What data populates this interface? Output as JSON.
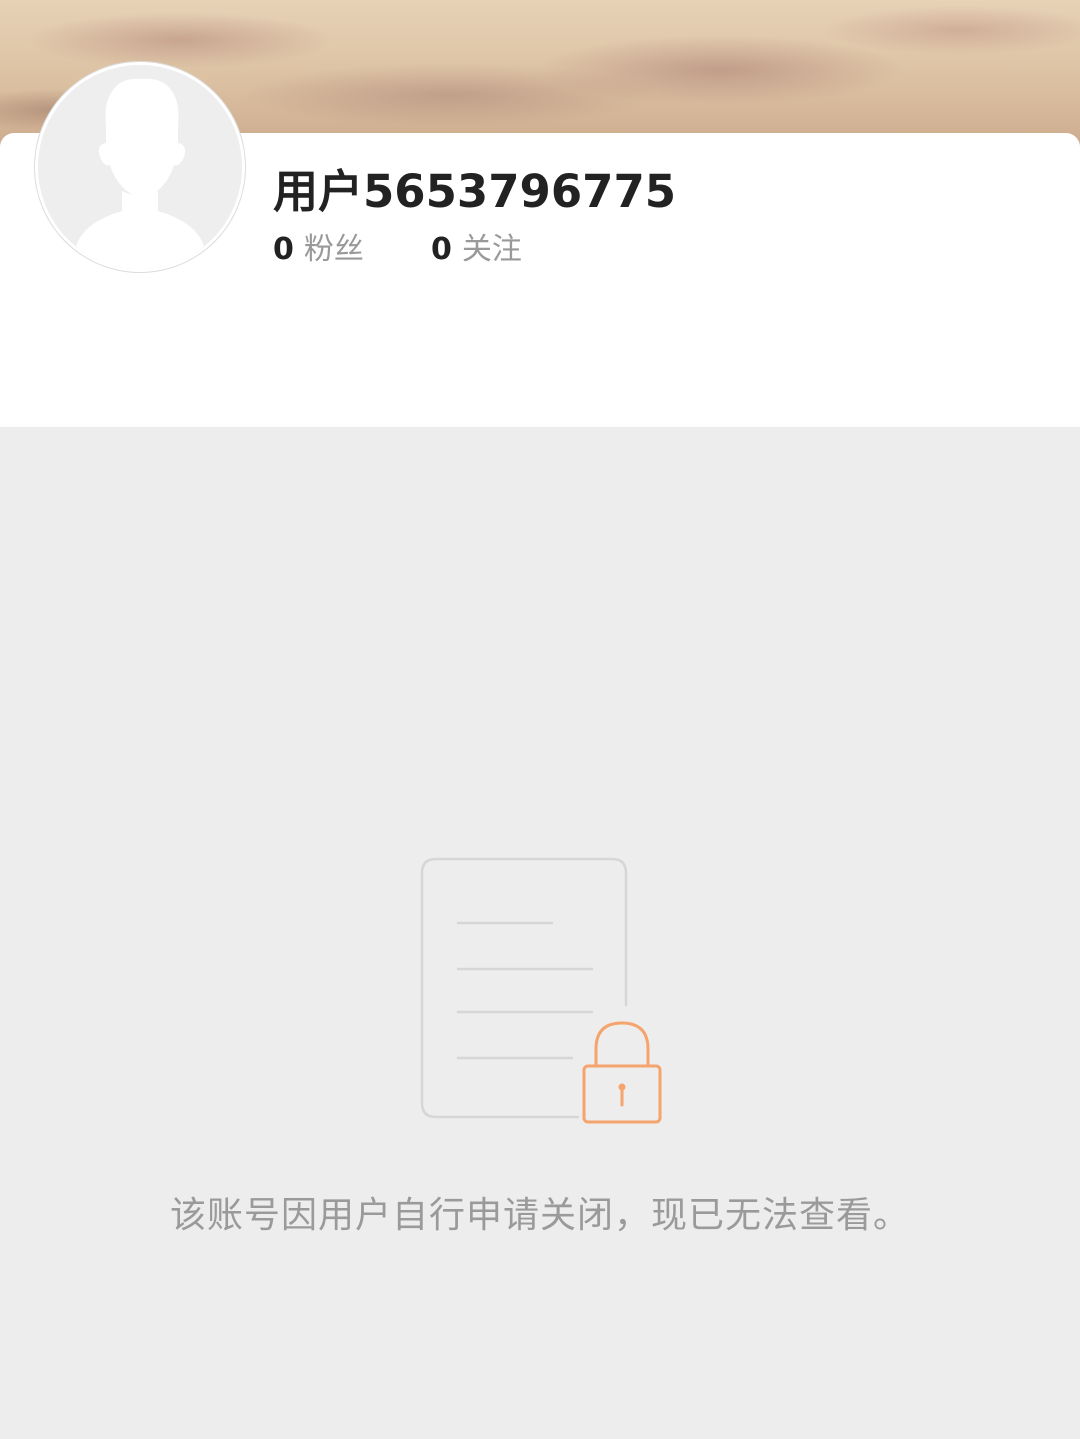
{
  "profile": {
    "username": "用户5653796775",
    "fans_count": "0",
    "fans_label": "粉丝",
    "following_count": "0",
    "following_label": "关注",
    "avatar_icon": "default-user-silhouette"
  },
  "status": {
    "message": "该账号因用户自行申请关闭，现已无法查看。",
    "icon": "document-lock-icon"
  },
  "colors": {
    "background": "#ededed",
    "card": "#ffffff",
    "lock_accent": "#f4a46c",
    "text_primary": "#222222",
    "text_secondary": "#999999"
  }
}
